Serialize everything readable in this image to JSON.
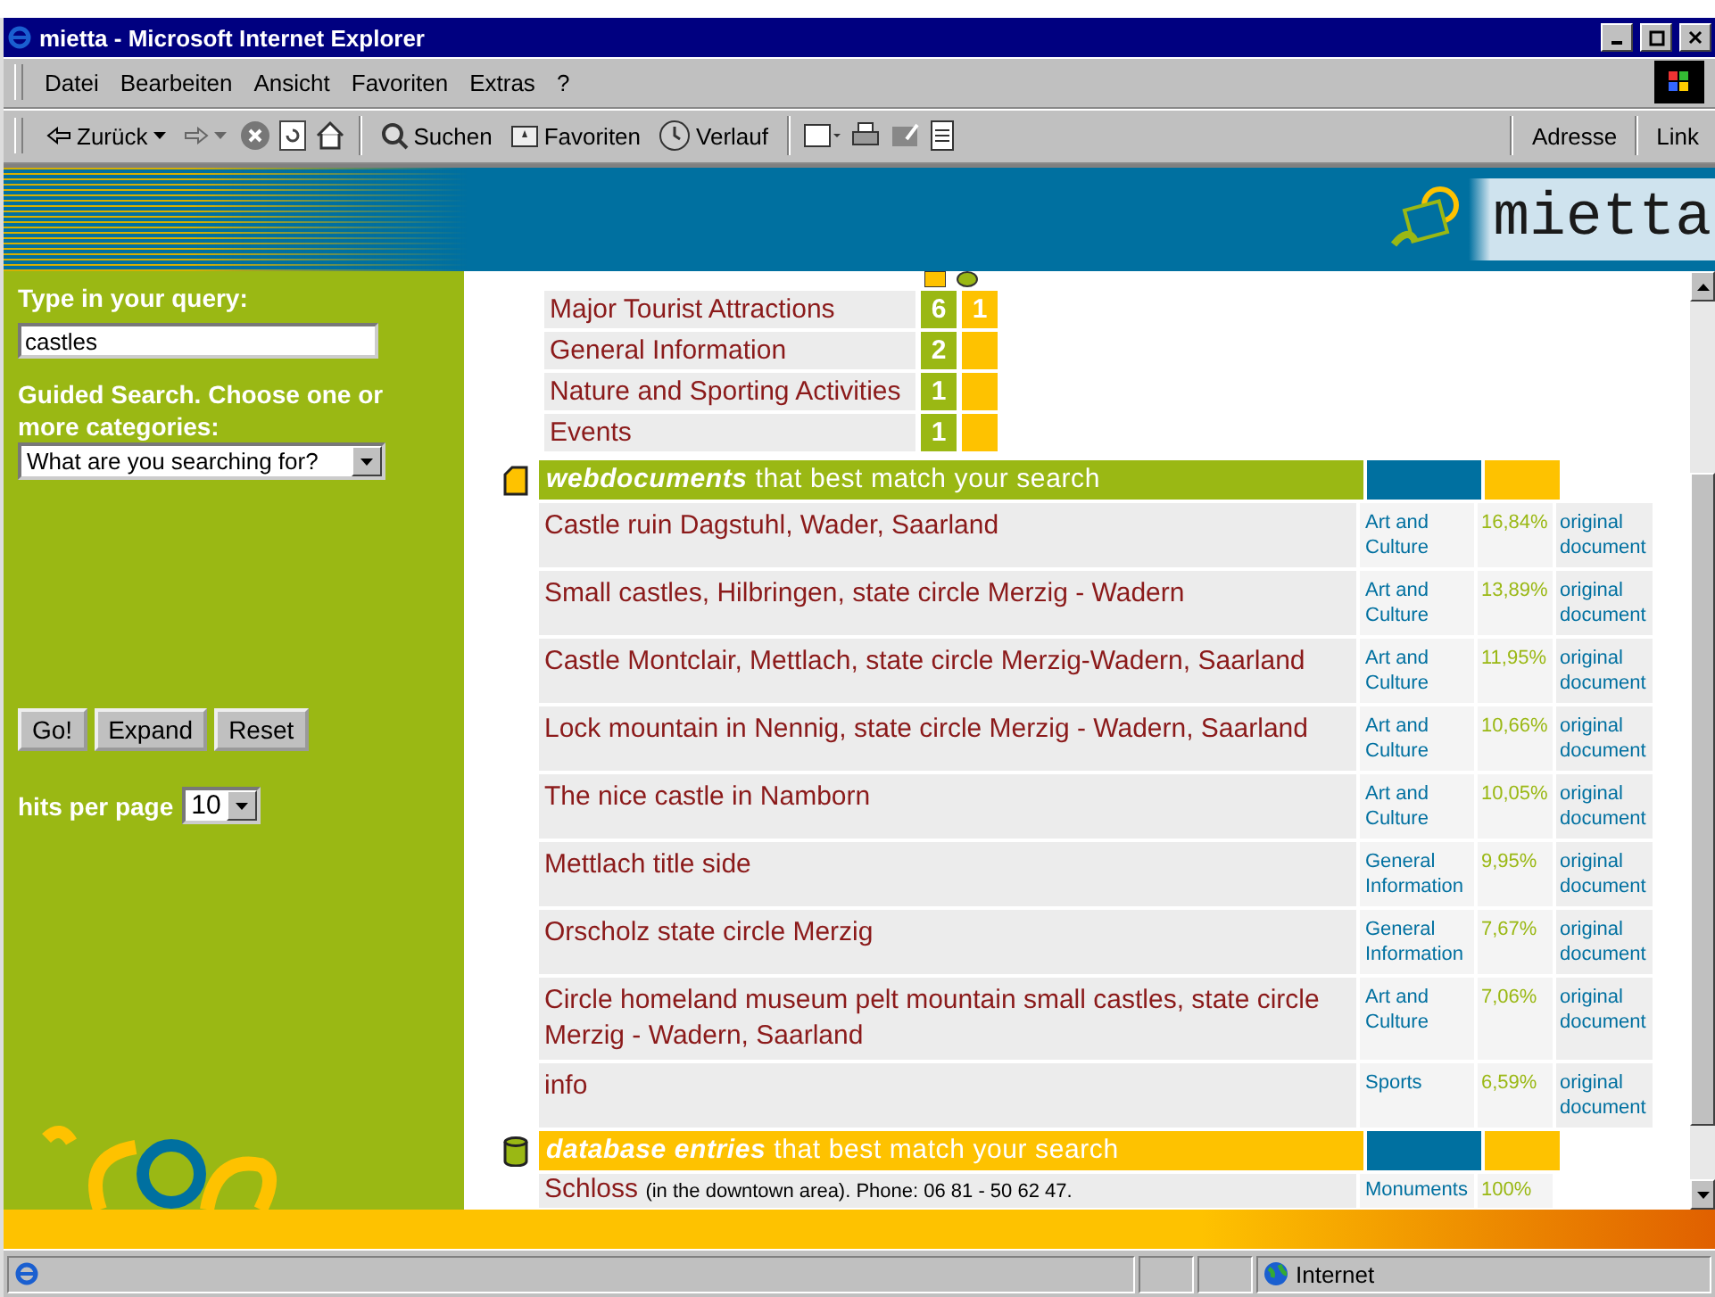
{
  "window": {
    "title": "mietta - Microsoft Internet Explorer"
  },
  "menu": [
    "Datei",
    "Bearbeiten",
    "Ansicht",
    "Favoriten",
    "Extras",
    "?"
  ],
  "toolbar": {
    "back": "Zurück",
    "search": "Suchen",
    "favorites": "Favoriten",
    "history": "Verlauf",
    "address": "Adresse",
    "links": "Link"
  },
  "header": {
    "logo": "mietta"
  },
  "sidebar": {
    "query_label": "Type in your query:",
    "query_value": "castles",
    "guided_label": "Guided Search. Choose one or more categories:",
    "guided_select": "What are you searching for?",
    "buttons": [
      "Go!",
      "Expand",
      "Reset"
    ],
    "hits_label": "hits per page",
    "hits_value": "10"
  },
  "categories": [
    {
      "name": "Major Tourist Attractions",
      "web_count": "6",
      "db_count": "1"
    },
    {
      "name": "General Information",
      "web_count": "2"
    },
    {
      "name": "Nature and Sporting Activities",
      "web_count": "1"
    },
    {
      "name": "Events",
      "web_count": "1"
    }
  ],
  "webdocuments": {
    "title_bold": "webdocuments",
    "title_rest": "that best match your search",
    "rows": [
      {
        "title": "Castle ruin Dagstuhl, Wader, Saarland",
        "category": "Art and Culture",
        "score": "16,84%",
        "link": "original document"
      },
      {
        "title": "Small castles, Hilbringen, state circle Merzig - Wadern",
        "category": "Art and Culture",
        "score": "13,89%",
        "link": "original document"
      },
      {
        "title": "Castle Montclair, Mettlach, state circle Merzig-Wadern, Saarland",
        "category": "Art and Culture",
        "score": "11,95%",
        "link": "original document"
      },
      {
        "title": "Lock mountain in Nennig, state circle Merzig - Wadern, Saarland",
        "category": "Art and Culture",
        "score": "10,66%",
        "link": "original document"
      },
      {
        "title": "The nice castle in Namborn",
        "category": "Art and Culture",
        "score": "10,05%",
        "link": "original document"
      },
      {
        "title": "Mettlach title side",
        "category": "General Information",
        "score": "9,95%",
        "link": "original document"
      },
      {
        "title": "Orscholz state circle Merzig",
        "category": "General Information",
        "score": "7,67%",
        "link": "original document"
      },
      {
        "title": "Circle homeland museum pelt mountain small castles, state circle Merzig - Wadern, Saarland",
        "category": "Art and Culture",
        "score": "7,06%",
        "link": "original document"
      },
      {
        "title": "info",
        "category": "Sports",
        "score": "6,59%",
        "link": "original document"
      }
    ]
  },
  "database": {
    "title_bold": "database entries",
    "title_rest": "that best match your search",
    "rows": [
      {
        "title": "Schloss",
        "detail": "(in the downtown area). Phone: 06 81 - 50 62 47.",
        "category": "Monuments",
        "score": "100%"
      }
    ]
  },
  "status_bar": {
    "zone": "Internet"
  }
}
